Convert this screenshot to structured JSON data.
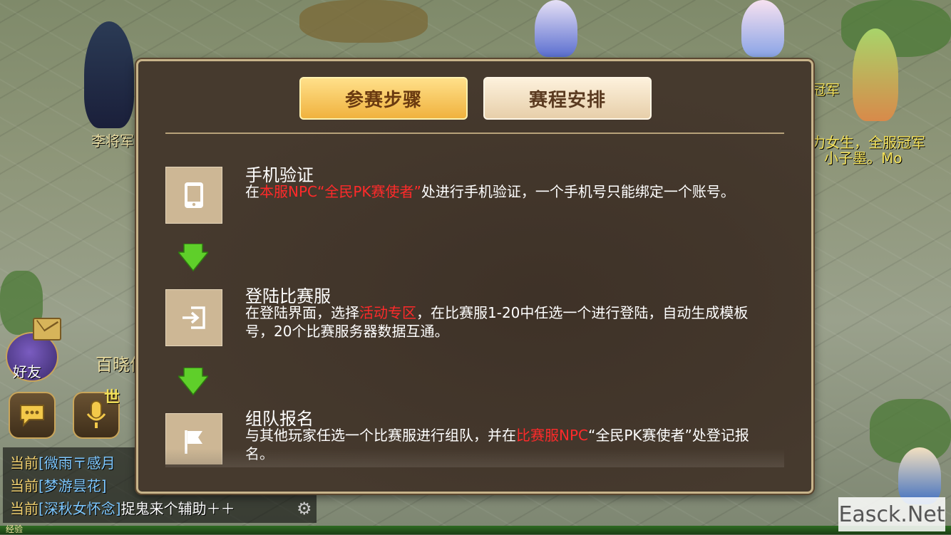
{
  "background": {
    "npc_names": [
      "李将军",
      "小子墨。Mo",
      "力女生，全服冠军",
      "冠军"
    ],
    "hud": {
      "friend_label": "好友",
      "baixiao_label": "百晓仙子",
      "world_tag": "世"
    },
    "chat": [
      {
        "tag": "当前",
        "name": "[微雨〒感月",
        "msg": ""
      },
      {
        "tag": "当前",
        "name": "[梦游昙花]",
        "msg": ""
      },
      {
        "tag": "当前",
        "name": "[深秋女怀念]",
        "msg": "捉鬼来个辅助＋＋"
      }
    ],
    "exp_label": "经验",
    "watermark": "Easck.Net"
  },
  "dialog": {
    "tabs": [
      {
        "label": "参赛步骤",
        "active": true
      },
      {
        "label": "赛程安排",
        "active": false
      }
    ],
    "steps": [
      {
        "icon": "phone-icon",
        "title": "手机验证",
        "desc_parts": [
          {
            "text": "在",
            "highlight": false
          },
          {
            "text": "本服NPC“全民PK赛使者”",
            "highlight": true
          },
          {
            "text": "处进行手机验证，一个手机号只能绑定一个账号。",
            "highlight": false
          }
        ]
      },
      {
        "icon": "login-icon",
        "title": "登陆比赛服",
        "desc_parts": [
          {
            "text": "在登陆界面，选择",
            "highlight": false
          },
          {
            "text": "活动专区",
            "highlight": true
          },
          {
            "text": "，在比赛服1-20中任选一个进行登陆，自动生成模板号，20个比赛服务器数据互通。",
            "highlight": false
          }
        ]
      },
      {
        "icon": "flag-icon",
        "title": "组队报名",
        "desc_parts": [
          {
            "text": "与其他玩家任选一个比赛服进行组队，并在",
            "highlight": false
          },
          {
            "text": "比赛服NPC",
            "highlight": true
          },
          {
            "text": "“全民PK赛使者”处登记报名。",
            "highlight": false
          }
        ]
      }
    ]
  },
  "colors": {
    "highlight": "#ff2a2a",
    "tab_active": "#f0b23e",
    "arrow_green": "#5fcf2a",
    "dialog_border": "#c8b48a"
  }
}
